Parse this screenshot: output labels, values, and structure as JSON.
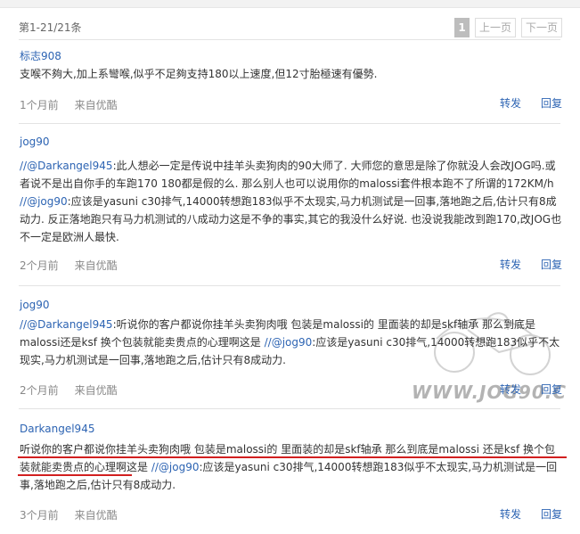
{
  "header": {
    "count_text": "第1-21/21条",
    "pager": {
      "current": "1",
      "prev": "上一页",
      "next": "下一页"
    }
  },
  "comments": [
    {
      "author": "标志908",
      "text": "支喉不夠大,加上系彎喉,似乎不足夠支持180以上速度,但12寸胎極速有優勢.",
      "time": "1个月前",
      "source": "来自优酷",
      "repost": "转发",
      "reply": "回复"
    },
    {
      "author": "jog90",
      "mention1": "//@Darkangel945",
      "text1": ":此人想必一定是传说中挂羊头卖狗肉的90大师了. 大师您的意思是除了你就没人会改JOG吗.或者说不是出自你手的车跑170 180都是假的么. 那么别人也可以说用你的malossi套件根本跑不了所谓的172KM/h ",
      "mention2": "//@jog90",
      "text2": ":应该是yasuni c30排气,14000转想跑183似乎不太现实,马力机测试是一回事,落地跑之后,估计只有8成动力. 反正落地跑只有马力机测试的八成动力这是不争的事实,其它的我没什么好说. 也没说我能改到跑170,改JOG也不一定是欧洲人最快.",
      "time": "2个月前",
      "source": "来自优酷",
      "repost": "转发",
      "reply": "回复"
    },
    {
      "author": "jog90",
      "mention1": "//@Darkangel945",
      "text1": ":听说你的客户都说你挂羊头卖狗肉哦 包装是malossi的 里面装的却是skf轴承 那么到底是malossi还是ksf 换个包装就能卖贵点的心理啊这是 ",
      "mention2": "//@jog90",
      "text2": ":应该是yasuni c30排气,14000转想跑183似乎不太现实,马力机测试是一回事,落地跑之后,估计只有8成动力.",
      "time": "2个月前",
      "source": "来自优酷",
      "repost": "转发",
      "reply": "回复"
    },
    {
      "author": "Darkangel945",
      "text1": "听说你的客户都说你挂羊头卖狗肉哦 包装是malossi的 里面装的却是skf轴承 那么到底是malossi 还是ksf 换个包装就能卖贵点的心理啊这是 ",
      "mention2": "//@jog90",
      "text2": ":应该是yasuni c30排气,14000转想跑183似乎不太现实,马力机测试是一回事,落地跑之后,估计只有8成动力.",
      "time": "3个月前",
      "source": "来自优酷",
      "repost": "转发",
      "reply": "回复"
    }
  ],
  "watermark": "WWW.JOG90.C",
  "colors": {
    "link": "#2d64b3",
    "annotation": "#d21f1f",
    "pager_current": "#bdbdbd"
  }
}
